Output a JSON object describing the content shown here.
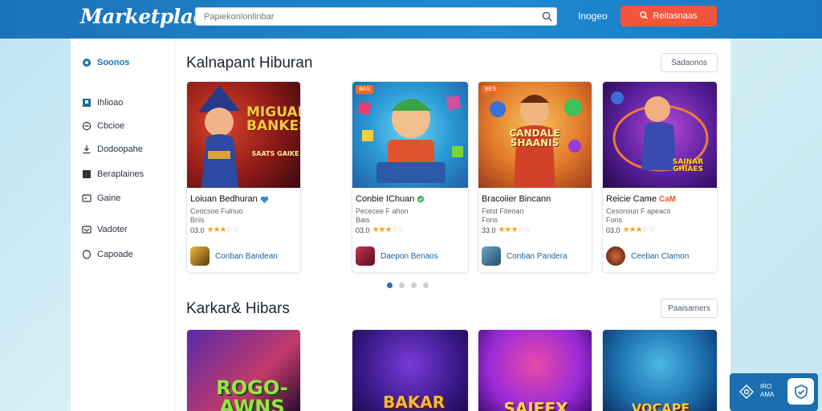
{
  "header": {
    "logo": "Marketplace",
    "search_placeholder": "Papiekonlonlinbar",
    "link": "Inogeo",
    "cta": "Reitasnaas"
  },
  "sidebar": {
    "items": [
      {
        "label": "Soonos",
        "icon": "circle-dot-icon",
        "active": true
      },
      {
        "label": "Ihlioao",
        "icon": "bookmark-icon"
      },
      {
        "label": "Cbcioe",
        "icon": "clock-icon"
      },
      {
        "label": "Dodoopahe",
        "icon": "download-icon"
      },
      {
        "label": "Beraplaines",
        "icon": "square-icon"
      },
      {
        "label": "Gaine",
        "icon": "gamepad-icon"
      },
      {
        "label": "Vadoter",
        "icon": "wallet-icon"
      },
      {
        "label": "Capoade",
        "icon": "ring-icon"
      }
    ]
  },
  "section1": {
    "title": "Kalnapant Hiburan",
    "button": "Sadaonos",
    "cards": [
      {
        "title": "Loiuan Bedhuran",
        "verified": "blue",
        "sub": "Ceocsoe Fulnuo",
        "tag": "Bnis",
        "rating": "03.0",
        "stars": 3,
        "dev": "Conban Bandean",
        "thumb": "MIGUAL BANKES",
        "thumb_sub": "SAATS GAIKE",
        "badge": ""
      },
      {
        "title": "Conbie IChuan",
        "verified": "green",
        "sub": "Pececee F ahon",
        "tag": "Bais",
        "rating": "03.0",
        "stars": 3,
        "dev": "Daepon Benaos",
        "thumb": "",
        "thumb_sub": "",
        "badge": "BAS"
      },
      {
        "title": "Bracoiier Bincann",
        "verified": "",
        "sub": "Fetst Fiteoan",
        "tag": "Fons",
        "rating": "33.0",
        "stars": 3,
        "dev": "Conban Pandera",
        "thumb": "CANDALE SHAANIS",
        "thumb_sub": "",
        "badge": "BES"
      },
      {
        "title": "Reicie Came",
        "verified": "orange",
        "sub": "Cesonsun F apeaco",
        "tag": "Fons",
        "rating": "03.0",
        "stars": 3,
        "dev": "Ceeban Clamon",
        "thumb": "SAINAR GHIAES",
        "thumb_sub": "",
        "badge": ""
      }
    ],
    "cam_label": "CaM"
  },
  "section2": {
    "title": "Karkar& Hibars",
    "button": "Paaisamers",
    "thumbs": [
      "ROGO-AWNS",
      "BAKAR",
      "SAIFEX",
      "VOCAPE"
    ]
  },
  "chat": {
    "label_top": "IRO",
    "label_bottom": "AMA"
  }
}
